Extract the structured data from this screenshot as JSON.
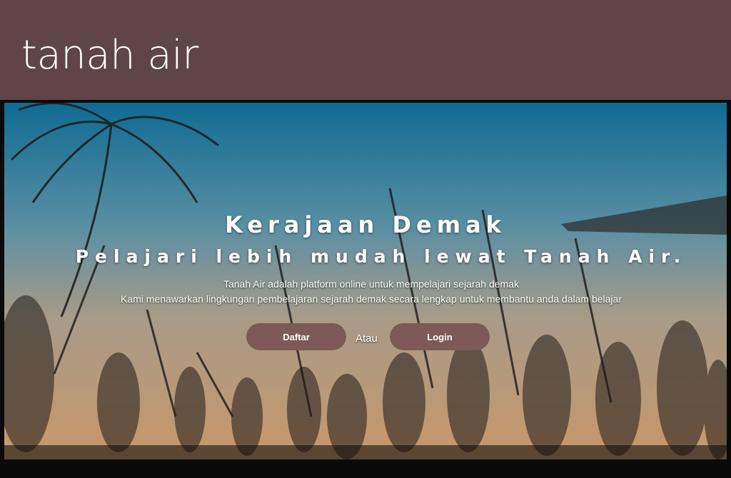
{
  "header": {
    "brand": "tanah air",
    "background_color": "#5f4547"
  },
  "hero": {
    "title": "Kerajaan Demak",
    "subtitle": "Pelajari lebih mudah lewat Tanah Air.",
    "description_line1": "Tanah Air adalah platform online untuk mempelajari sejarah demak",
    "description_line2": "Kami menawarkan lingkungan pembelajaran sejarah demak secara lengkap untuk membantu  anda dalam belajar",
    "separator_text": "Atau",
    "background_image": "historical-procession-sketch",
    "gradient_colors": [
      "#0e6f95",
      "#c6966a"
    ]
  },
  "actions": {
    "register_label": "Daftar",
    "login_label": "Login",
    "button_color": "#7d5a58"
  }
}
